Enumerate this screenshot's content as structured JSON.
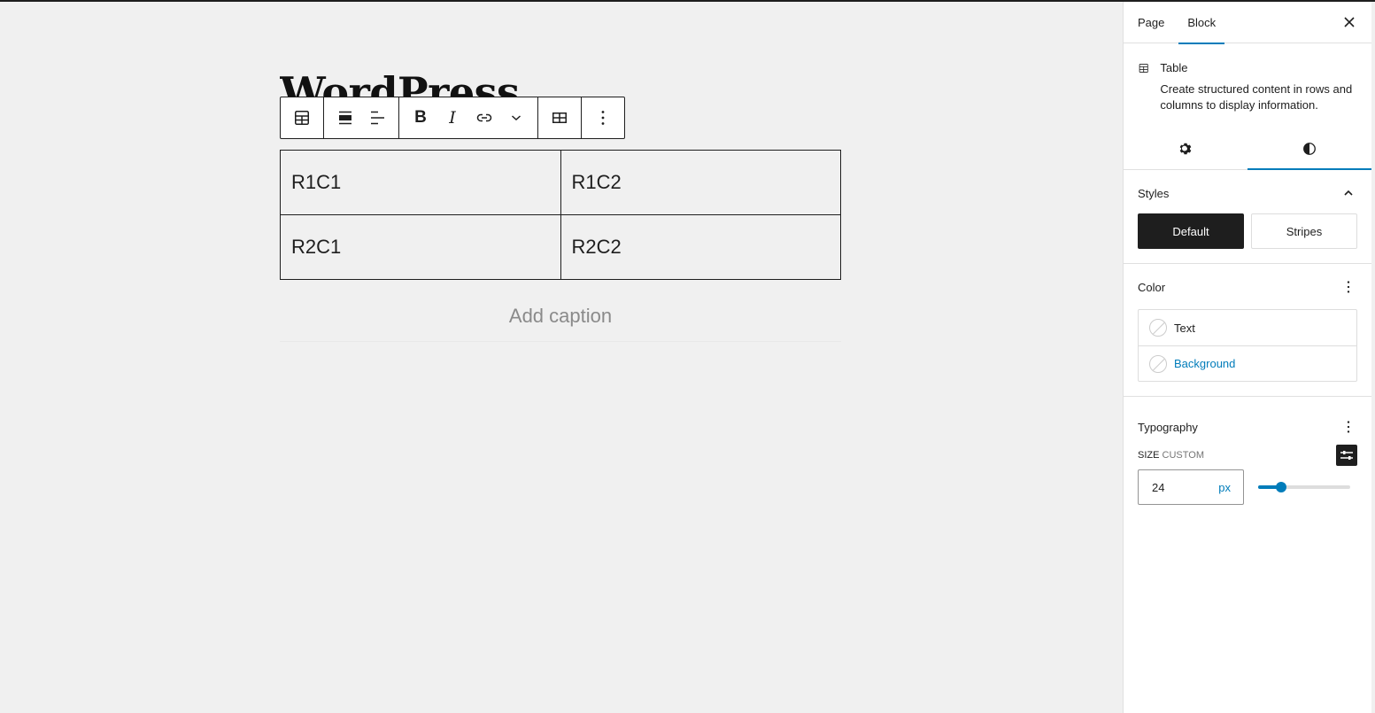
{
  "editor": {
    "post_title": "WordPress",
    "toolbar": {
      "groups": [
        [
          {
            "name": "block-type-table",
            "icon": "table-icon"
          }
        ],
        [
          {
            "name": "align",
            "icon": "align-wide-icon"
          },
          {
            "name": "text-align",
            "icon": "align-left-icon"
          }
        ],
        [
          {
            "name": "bold",
            "label": "B"
          },
          {
            "name": "italic",
            "label": "I"
          },
          {
            "name": "link",
            "icon": "link-icon"
          },
          {
            "name": "more-rich-text",
            "icon": "chevron-down-icon"
          }
        ],
        [
          {
            "name": "edit-table",
            "icon": "table-edit-icon"
          }
        ],
        [
          {
            "name": "options",
            "icon": "more-vertical-icon"
          }
        ]
      ]
    },
    "table": {
      "rows": [
        [
          "R1C1",
          "R1C2"
        ],
        [
          "R2C1",
          "R2C2"
        ]
      ]
    },
    "caption_placeholder": "Add caption"
  },
  "sidebar": {
    "tabs": [
      {
        "label": "Page",
        "active": false
      },
      {
        "label": "Block",
        "active": true
      }
    ],
    "close_icon": "close-icon",
    "block": {
      "title": "Table",
      "description": "Create structured content in rows and columns to display information."
    },
    "sub_tabs": [
      {
        "name": "settings",
        "icon": "gear-icon",
        "active": false
      },
      {
        "name": "styles",
        "icon": "contrast-icon",
        "active": true
      }
    ],
    "styles_panel": {
      "title": "Styles",
      "options": [
        {
          "label": "Default",
          "active": true
        },
        {
          "label": "Stripes",
          "active": false
        }
      ]
    },
    "color_panel": {
      "title": "Color",
      "items": [
        {
          "label": "Text"
        },
        {
          "label": "Background"
        }
      ]
    },
    "typography_panel": {
      "title": "Typography",
      "size_label": "Size",
      "size_sublabel": "Custom",
      "size_value": "24",
      "size_unit": "px",
      "slider_fraction": 0.25
    },
    "accent_color": "#007cba"
  }
}
